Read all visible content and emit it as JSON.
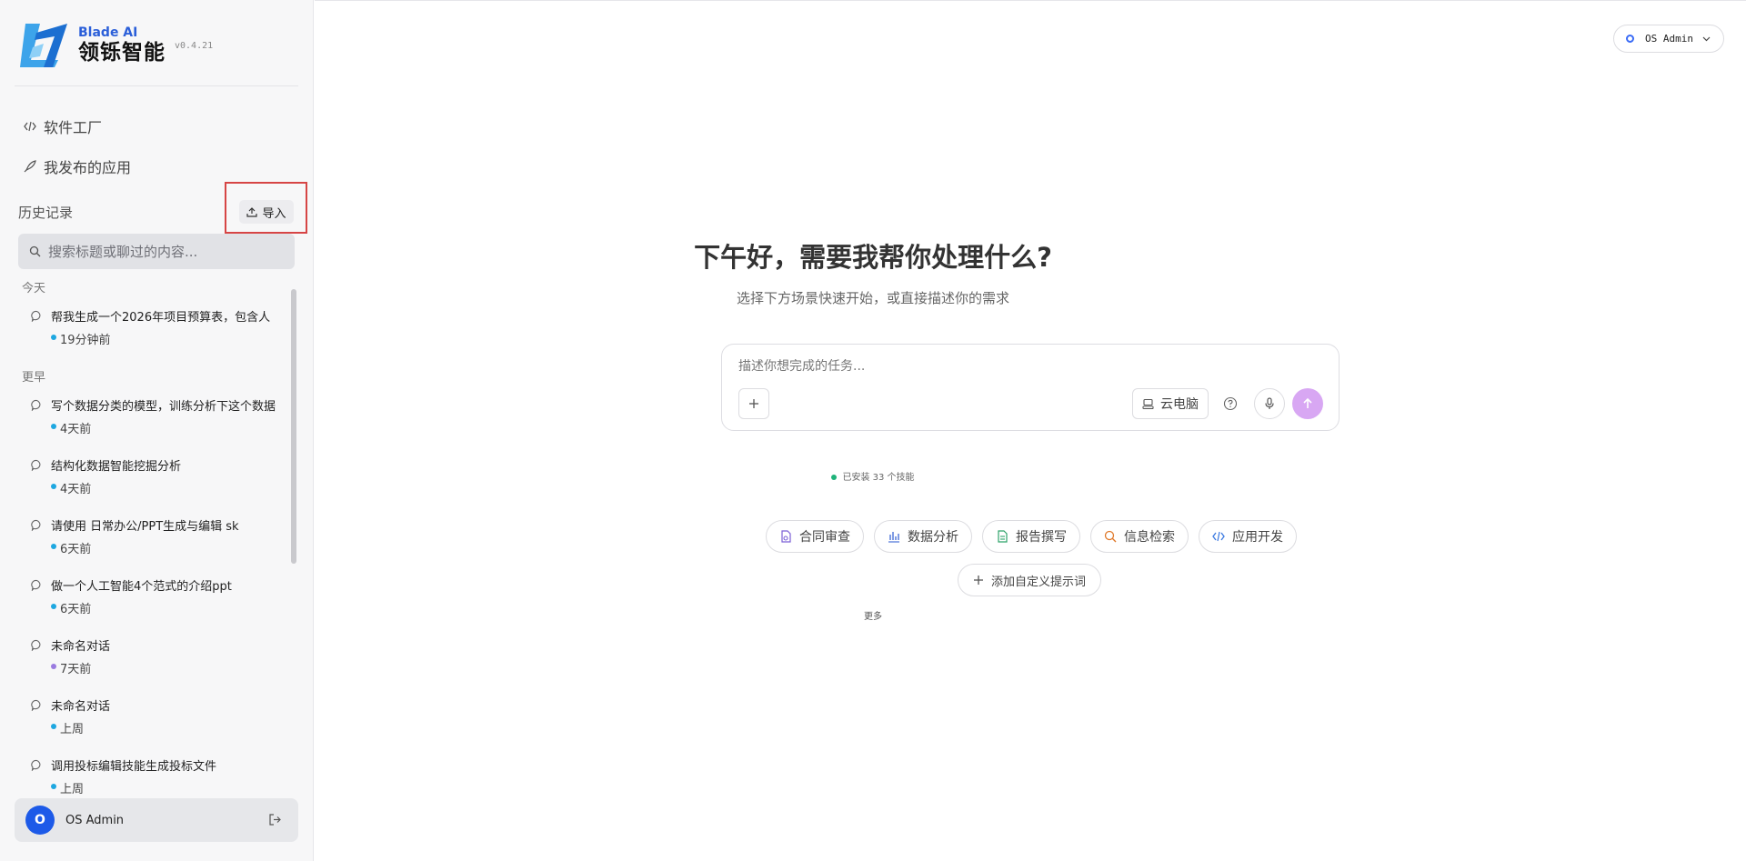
{
  "brand": {
    "name_en": "Blade AI",
    "name_cn": "领铄智能",
    "version": "v0.4.21"
  },
  "nav": {
    "software_factory": "软件工厂",
    "my_published_apps": "我发布的应用"
  },
  "history": {
    "title": "历史记录",
    "import_label": "导入",
    "search_placeholder": "搜索标题或聊过的内容...",
    "sections": {
      "today": "今天",
      "earlier": "更早"
    },
    "items": [
      {
        "title": "帮我生成一个2026年项目预算表，包含人",
        "time": "19分钟前",
        "dot_color": "#1ea7e0"
      },
      {
        "title": "写个数据分类的模型，训练分析下这个数据",
        "time": "4天前",
        "dot_color": "#1ea7e0"
      },
      {
        "title": "结构化数据智能挖掘分析",
        "time": "4天前",
        "dot_color": "#1ea7e0"
      },
      {
        "title": "请使用 日常办公/PPT生成与编辑 sk",
        "time": "6天前",
        "dot_color": "#1ea7e0"
      },
      {
        "title": "做一个人工智能4个范式的介绍ppt",
        "time": "6天前",
        "dot_color": "#1ea7e0"
      },
      {
        "title": "未命名对话",
        "time": "7天前",
        "dot_color": "#9a7be0"
      },
      {
        "title": "未命名对话",
        "time": "上周",
        "dot_color": "#1ea7e0"
      },
      {
        "title": "调用投标编辑技能生成投标文件",
        "time": "上周",
        "dot_color": "#1ea7e0"
      }
    ]
  },
  "user": {
    "avatar_letter": "O",
    "name": "OS Admin"
  },
  "header": {
    "account_label": "OS Admin"
  },
  "main": {
    "greeting": "下午好，需要我帮你处理什么?",
    "subtitle": "选择下方场景快速开始，或直接描述你的需求",
    "composer_placeholder": "描述你想完成的任务...",
    "cloud_pc_label": "云电脑",
    "skills_text": "已安装 33 个技能",
    "chips": [
      {
        "label": "合同审查",
        "icon": "contract-icon",
        "color": "#7b5fd6"
      },
      {
        "label": "数据分析",
        "icon": "bar-chart-icon",
        "color": "#4a72d9"
      },
      {
        "label": "报告撰写",
        "icon": "document-icon",
        "color": "#2fa36a"
      },
      {
        "label": "信息检索",
        "icon": "search-icon",
        "color": "#e07a2b"
      },
      {
        "label": "应用开发",
        "icon": "code-icon",
        "color": "#3a78e0"
      }
    ],
    "custom_prompt_label": "添加自定义提示词",
    "more_label": "更多"
  },
  "colors": {
    "accent": "#1d5ae8",
    "send_button": "#d8a7f3",
    "highlight": "#d64545"
  }
}
